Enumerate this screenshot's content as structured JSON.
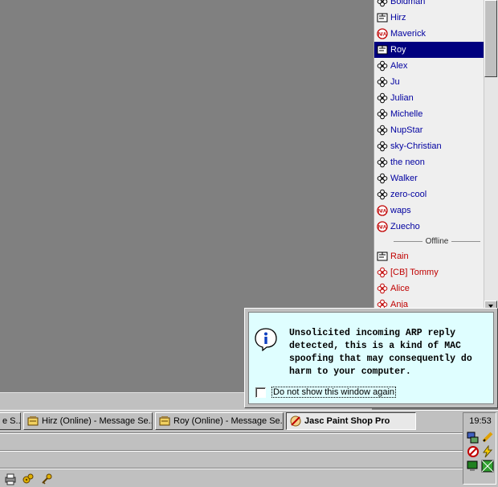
{
  "contacts": {
    "items": [
      {
        "name": "Boldman",
        "icon": "flower-icon",
        "status": "online"
      },
      {
        "name": "Hirz",
        "icon": "away-icon",
        "status": "online"
      },
      {
        "name": "Maverick",
        "icon": "na-icon",
        "status": "online"
      },
      {
        "name": "Roy",
        "icon": "away-icon",
        "status": "online",
        "selected": true
      },
      {
        "name": "Alex",
        "icon": "flower-icon",
        "status": "online"
      },
      {
        "name": "Ju",
        "icon": "flower-icon",
        "status": "online"
      },
      {
        "name": "Julian",
        "icon": "flower-icon",
        "status": "online"
      },
      {
        "name": "Michelle",
        "icon": "flower-icon",
        "status": "online"
      },
      {
        "name": "NupStar",
        "icon": "flower-icon",
        "status": "online"
      },
      {
        "name": "sky-Christian",
        "icon": "flower-icon",
        "status": "online"
      },
      {
        "name": "the neon",
        "icon": "flower-icon",
        "status": "online"
      },
      {
        "name": "Walker",
        "icon": "flower-icon",
        "status": "online"
      },
      {
        "name": "zero-cool",
        "icon": "flower-icon",
        "status": "online"
      },
      {
        "name": "waps",
        "icon": "na-icon",
        "status": "online"
      },
      {
        "name": "Zuecho",
        "icon": "na-icon",
        "status": "online"
      }
    ],
    "offline_header": "Offline",
    "offline_items": [
      {
        "name": "Rain",
        "icon": "away-icon"
      },
      {
        "name": "[CB] Tommy",
        "icon": "offline-flower-icon"
      },
      {
        "name": "Alice",
        "icon": "offline-flower-icon"
      },
      {
        "name": "Anja",
        "icon": "offline-flower-icon"
      }
    ]
  },
  "popup": {
    "message": "Unsolicited incoming ARP reply detected, this is a kind of MAC spoofing that may consequently do harm to your computer.",
    "checkbox_label": "Do not show this window again",
    "checked": false,
    "icon": "info-icon"
  },
  "taskbar": {
    "tasks": [
      {
        "label": "e S...",
        "icon": "none"
      },
      {
        "label": "Hirz (Online) - Message Se...",
        "icon": "chat-icon"
      },
      {
        "label": "Roy (Online) - Message Se...",
        "icon": "chat-icon"
      },
      {
        "label": "Jasc Paint Shop Pro",
        "icon": "paint-icon",
        "active": true
      }
    ],
    "clock": "19:53",
    "tray_icons": [
      "network-icon",
      "pencil-icon",
      "firewall-icon",
      "lightning-icon",
      "monitor-icon",
      "grid-icon"
    ],
    "quick_launch_icons": [
      "printer-icon",
      "gears-icon",
      "key-icon"
    ]
  }
}
